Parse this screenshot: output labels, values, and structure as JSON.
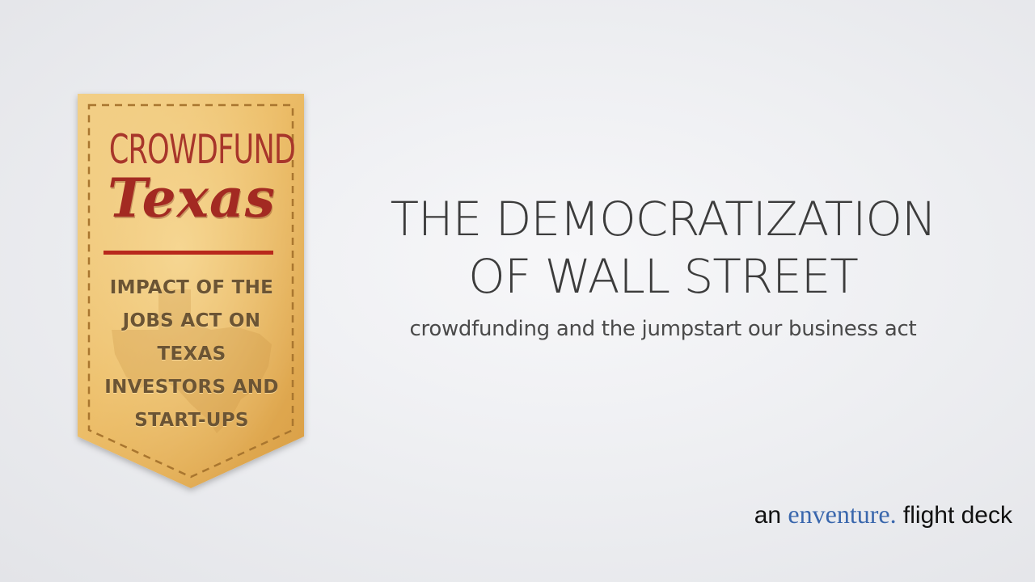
{
  "badge": {
    "brand_top": "CROWDFUND",
    "brand_main": "Texas",
    "subtitle_lines": [
      "IMPACT OF THE",
      "JOBS ACT ON",
      "TEXAS",
      "INVESTORS AND",
      "START-UPS"
    ],
    "colors": {
      "gold": "#e9b85f",
      "gold_light": "#f3d089",
      "red": "#a32a22",
      "dash": "#b07a2f"
    }
  },
  "title": {
    "line1": "THE DEMOCRATIZATION",
    "line2": "OF WALL STREET",
    "subtitle": "crowdfunding and the jumpstart our business act"
  },
  "footer": {
    "prefix": "an",
    "brand": "enventure.",
    "suffix": "flight deck",
    "brand_color": "#3a67ad"
  }
}
